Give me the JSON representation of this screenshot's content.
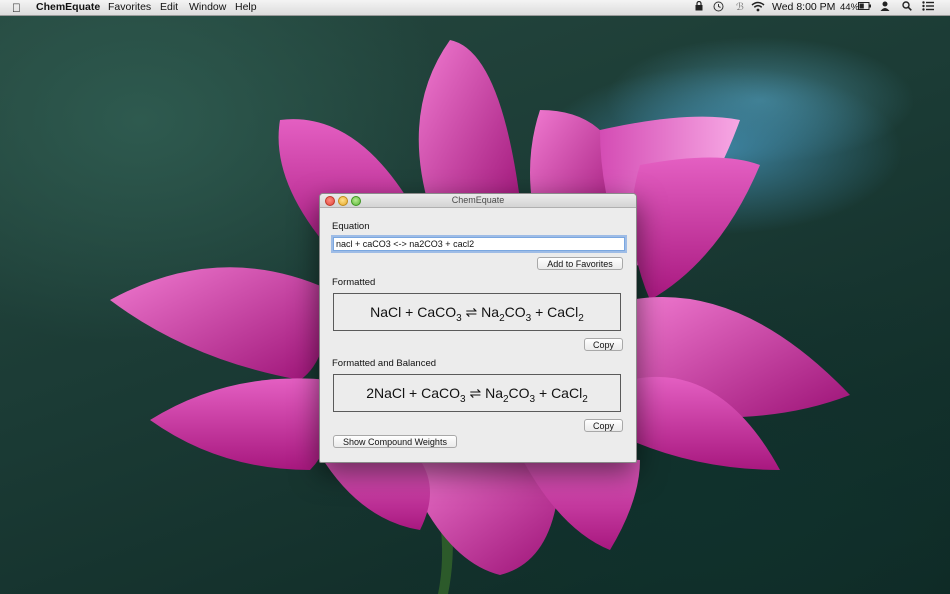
{
  "menubar": {
    "app_name": "ChemEquate",
    "menus": [
      "Favorites",
      "Edit",
      "Window",
      "Help"
    ],
    "clock": "Wed 8:00 PM",
    "battery": "44%",
    "icons": [
      "lock-icon",
      "time-machine-icon",
      "bluetooth-icon",
      "wifi-icon",
      "battery-icon",
      "user-icon",
      "spotlight-icon",
      "notification-center-icon"
    ]
  },
  "window": {
    "title": "ChemEquate",
    "equation_label": "Equation",
    "equation_value": "nacl + caCO3 <-> na2CO3 + cacl2",
    "add_favorites_label": "Add to Favorites",
    "formatted_label": "Formatted",
    "formatted_equation": [
      {
        "t": "NaCl + CaCO"
      },
      {
        "s": "3"
      },
      {
        "t": " ⇌ Na"
      },
      {
        "s": "2"
      },
      {
        "t": "CO"
      },
      {
        "s": "3"
      },
      {
        "t": " + CaCl"
      },
      {
        "s": "2"
      }
    ],
    "copy_label_1": "Copy",
    "balanced_label": "Formatted and Balanced",
    "balanced_equation": [
      {
        "t": "2NaCl + CaCO"
      },
      {
        "s": "3"
      },
      {
        "t": " ⇌ Na"
      },
      {
        "s": "2"
      },
      {
        "t": "CO"
      },
      {
        "s": "3"
      },
      {
        "t": " + CaCl"
      },
      {
        "s": "2"
      }
    ],
    "copy_label_2": "Copy",
    "compound_weights_label": "Show Compound Weights"
  }
}
